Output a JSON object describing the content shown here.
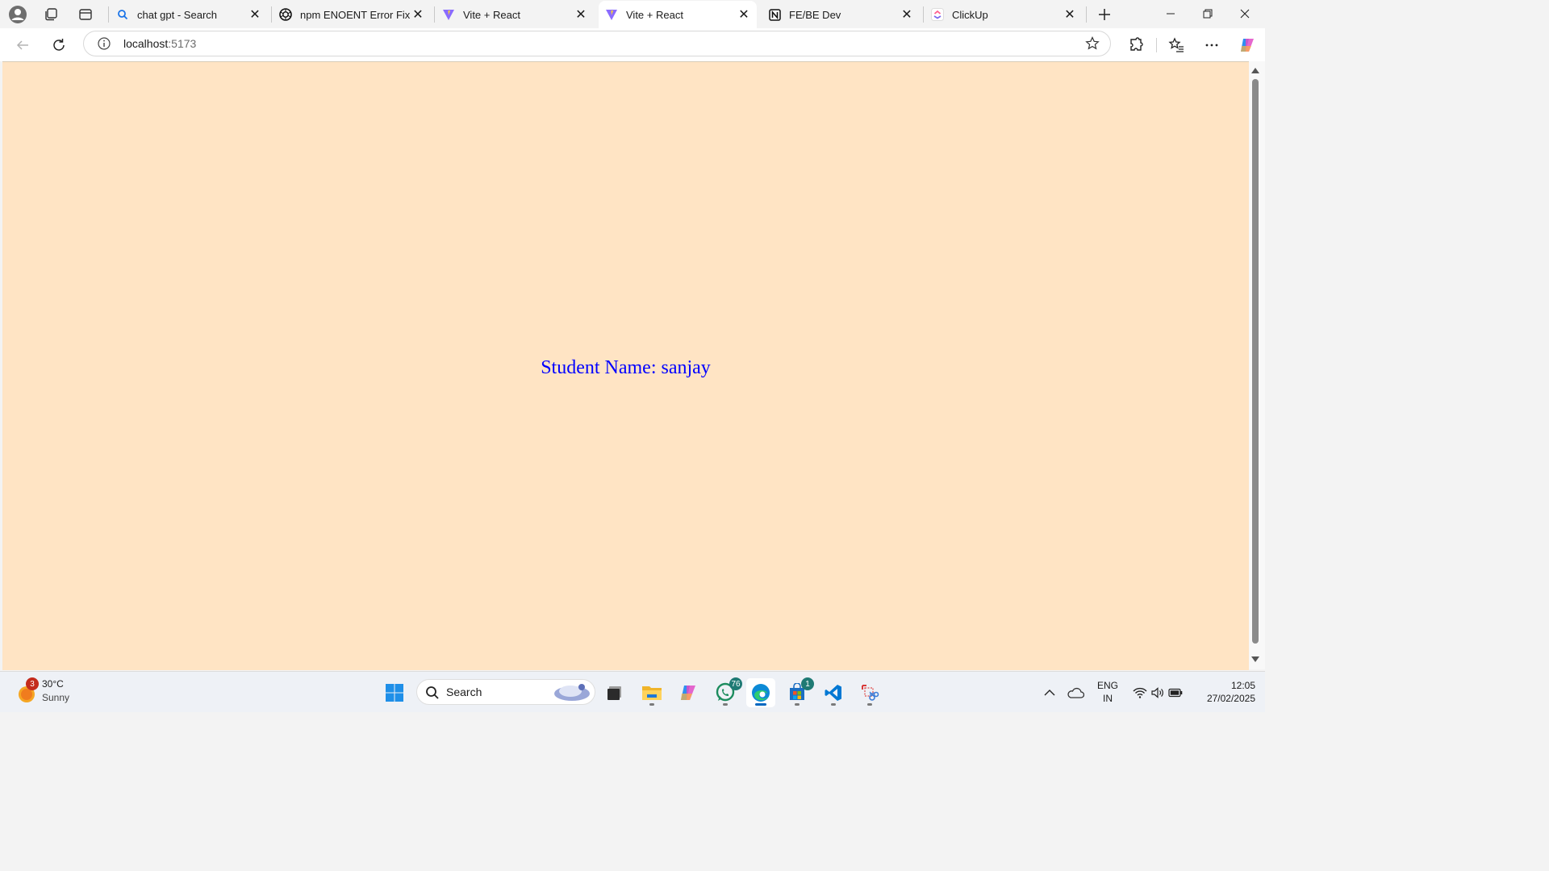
{
  "tabs": [
    {
      "title": "chat gpt - Search",
      "icon": "search-icon",
      "active": false
    },
    {
      "title": "npm ENOENT Error Fix",
      "icon": "openai-icon",
      "active": false
    },
    {
      "title": "Vite + React",
      "icon": "vite-icon",
      "active": false
    },
    {
      "title": "Vite + React",
      "icon": "vite-icon",
      "active": true
    },
    {
      "title": "FE/BE Dev",
      "icon": "notion-icon",
      "active": false
    },
    {
      "title": "ClickUp",
      "icon": "clickup-icon",
      "active": false
    }
  ],
  "address_bar": {
    "host": "localhost",
    "port": ":5173"
  },
  "page": {
    "student_label": "Student Name: sanjay",
    "background": "#ffe4c4",
    "text_color": "#0000ff"
  },
  "taskbar": {
    "weather": {
      "temp": "30°C",
      "condition": "Sunny",
      "badge": "3"
    },
    "search_label": "Search",
    "apps": [
      {
        "name": "windows-start",
        "badge": ""
      },
      {
        "name": "task-view",
        "badge": ""
      },
      {
        "name": "file-explorer",
        "badge": ""
      },
      {
        "name": "copilot",
        "badge": ""
      },
      {
        "name": "whatsapp",
        "badge": "76"
      },
      {
        "name": "edge",
        "badge": ""
      },
      {
        "name": "microsoft-store",
        "badge": "1"
      },
      {
        "name": "vscode",
        "badge": ""
      },
      {
        "name": "snipping-tool",
        "badge": ""
      }
    ],
    "lang_line1": "ENG",
    "lang_line2": "IN",
    "time": "12:05",
    "date": "27/02/2025"
  }
}
